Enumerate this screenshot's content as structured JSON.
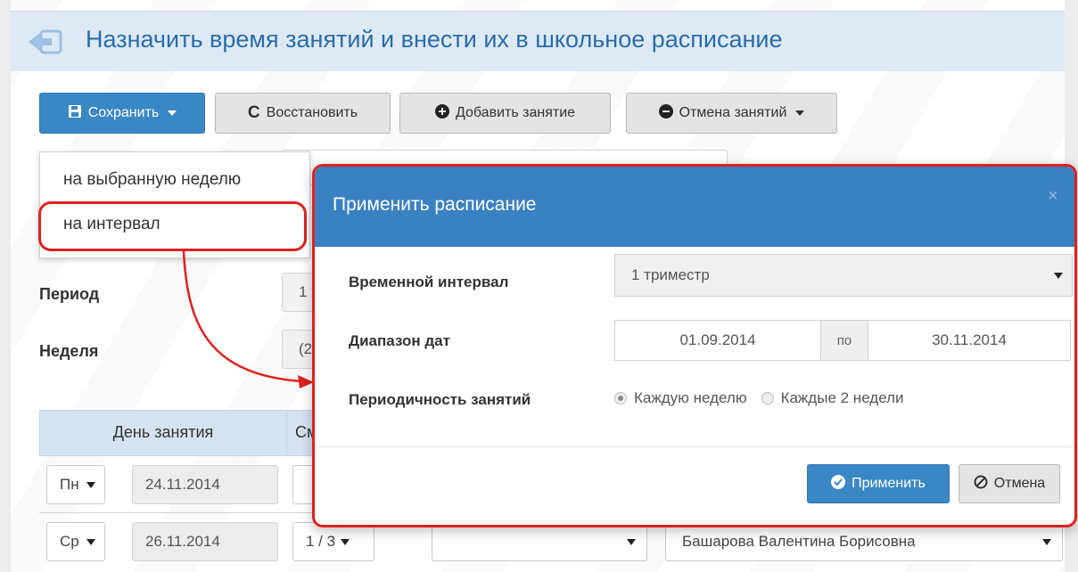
{
  "header": {
    "title": "Назначить время занятий и внести их в школьное расписание",
    "back_icon": "back-arrow-icon"
  },
  "toolbar": {
    "save_label": "Сохранить",
    "restore_label": "Восстановить",
    "add_lesson_label": "Добавить занятие",
    "cancel_lessons_label": "Отмена занятий"
  },
  "save_dropdown": {
    "items": [
      "на выбранную неделю",
      "на интервал"
    ]
  },
  "filters": {
    "period_label": "Период",
    "period_value": "1",
    "week_label": "Неделя",
    "week_value": "(2"
  },
  "table": {
    "col_day": "День занятия",
    "col_second": "См",
    "rows": [
      {
        "weekday": "Пн",
        "date": "24.11.2014"
      },
      {
        "weekday": "Ср",
        "date": "26.11.2014",
        "lesson": "1 / 3",
        "teacher": "Башарова Валентина Борисовна"
      }
    ]
  },
  "modal": {
    "title": "Применить расписание",
    "close": "×",
    "interval_label": "Временной интервал",
    "interval_value": "1 триместр",
    "range_label": "Диапазон дат",
    "date_from": "01.09.2014",
    "date_sep": "по",
    "date_to": "30.11.2014",
    "periodicity_label": "Периодичность занятий",
    "option_weekly": "Каждую неделю",
    "option_biweekly": "Каждые 2 недели",
    "apply_label": "Применить",
    "cancel_label": "Отмена"
  },
  "colors": {
    "primary": "#3a87c5",
    "header_bg": "#dde9f5",
    "highlight": "#e02020"
  }
}
